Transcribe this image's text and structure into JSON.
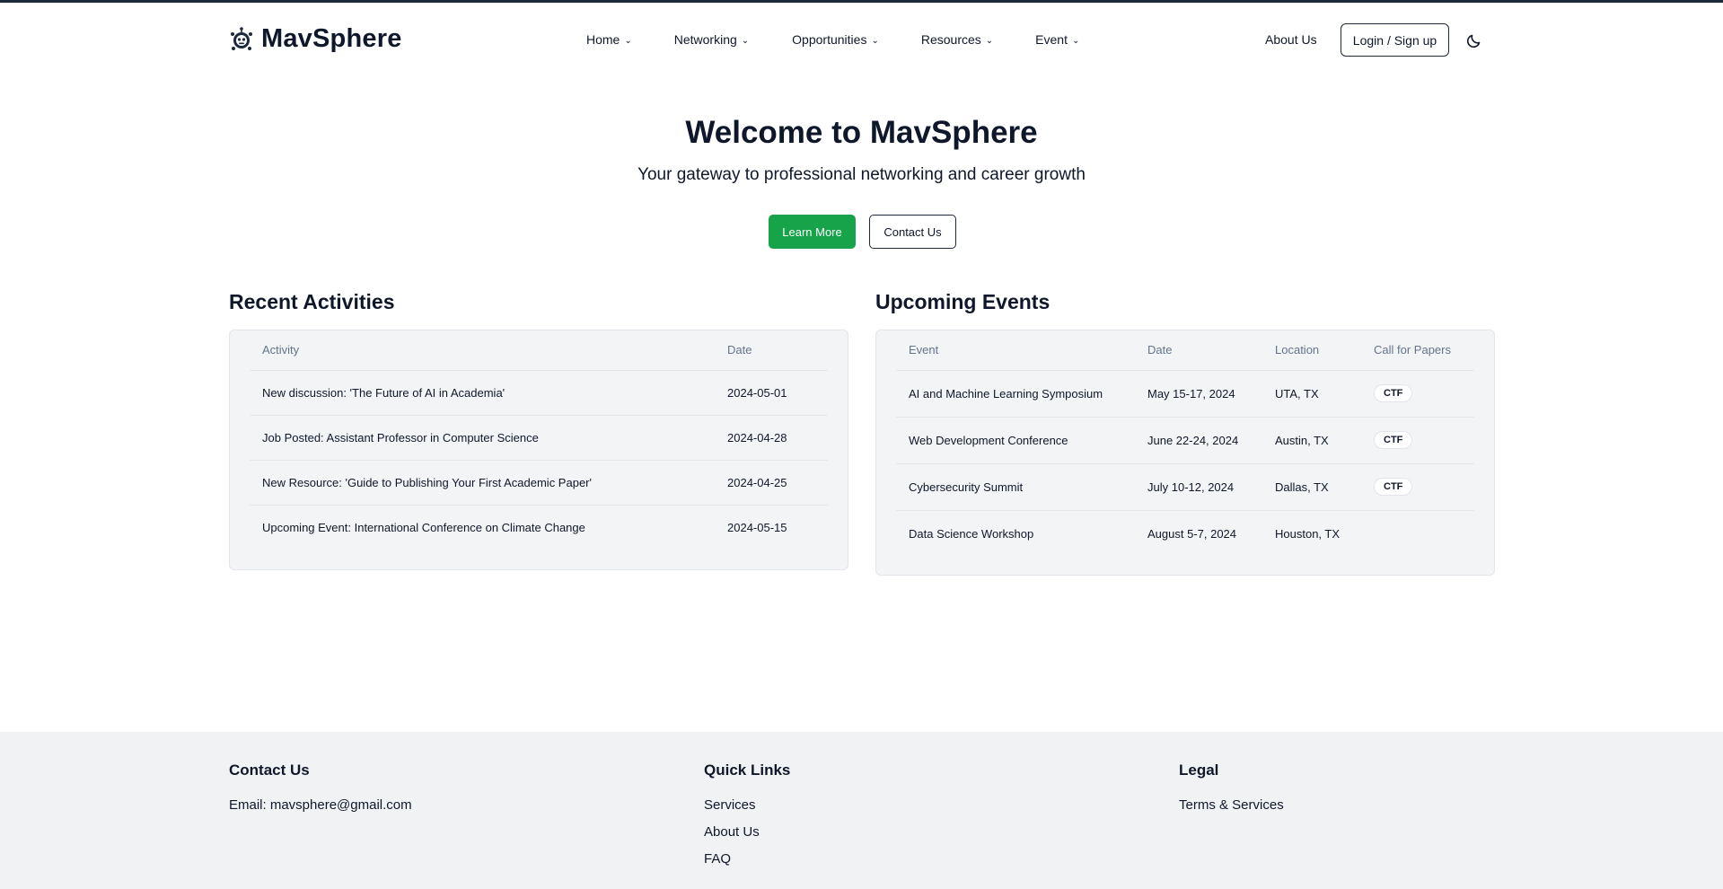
{
  "brand": {
    "name": "MavSphere"
  },
  "nav": {
    "items": [
      {
        "label": "Home"
      },
      {
        "label": "Networking"
      },
      {
        "label": "Opportunities"
      },
      {
        "label": "Resources"
      },
      {
        "label": "Event"
      }
    ],
    "about_label": "About Us",
    "login_label": "Login / Sign up"
  },
  "hero": {
    "title": "Welcome to MavSphere",
    "subtitle": "Your gateway to professional networking and career growth",
    "learn_more_label": "Learn More",
    "contact_label": "Contact Us"
  },
  "activities": {
    "title": "Recent Activities",
    "headers": [
      "Activity",
      "Date"
    ],
    "rows": [
      [
        "New discussion: 'The Future of AI in Academia'",
        "2024-05-01"
      ],
      [
        "Job Posted: Assistant Professor in Computer Science",
        "2024-04-28"
      ],
      [
        "New Resource: 'Guide to Publishing Your First Academic Paper'",
        "2024-04-25"
      ],
      [
        "Upcoming Event: International Conference on Climate Change",
        "2024-05-15"
      ]
    ]
  },
  "events": {
    "title": "Upcoming Events",
    "headers": [
      "Event",
      "Date",
      "Location",
      "Call for Papers"
    ],
    "rows": [
      [
        "AI and Machine Learning Symposium",
        "May 15-17, 2024",
        "UTA, TX",
        "CTF"
      ],
      [
        "Web Development Conference",
        "June 22-24, 2024",
        "Austin, TX",
        "CTF"
      ],
      [
        "Cybersecurity Summit",
        "July 10-12, 2024",
        "Dallas, TX",
        "CTF"
      ],
      [
        "Data Science Workshop",
        "August 5-7, 2024",
        "Houston, TX",
        ""
      ]
    ]
  },
  "footer": {
    "contact": {
      "title": "Contact Us",
      "email": "Email: mavsphere@gmail.com"
    },
    "quick_links": {
      "title": "Quick Links",
      "links": [
        "Services",
        "About Us",
        "FAQ"
      ]
    },
    "legal": {
      "title": "Legal",
      "links": [
        "Terms & Services"
      ]
    }
  },
  "colors": {
    "primary_button": "#16a34a",
    "text": "#0f172a",
    "card_bg": "#f3f4f6",
    "footer_bg": "#f1f2f4"
  },
  "icons": {
    "logo": "robot-logo-icon",
    "theme_toggle": "moon-icon",
    "dropdown": "chevron-down-icon"
  }
}
